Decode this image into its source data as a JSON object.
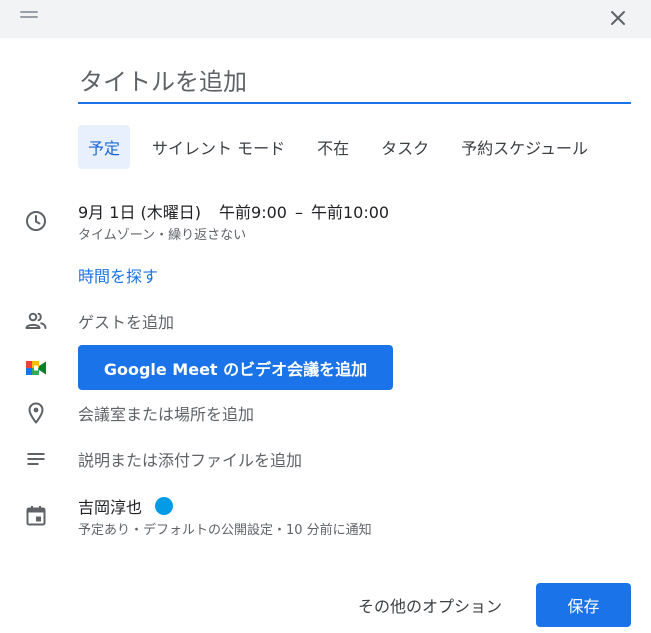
{
  "dialog": {
    "close_label": "×"
  },
  "title_field": {
    "placeholder": "タイトルを追加",
    "value": ""
  },
  "tabs": [
    {
      "label": "予定",
      "active": true
    },
    {
      "label": "サイレント モード",
      "active": false
    },
    {
      "label": "不在",
      "active": false
    },
    {
      "label": "タスク",
      "active": false
    },
    {
      "label": "予約スケジュール",
      "active": false
    }
  ],
  "datetime": {
    "date": "9月 1日 (木曜日)",
    "start": "午前9:00",
    "separator": "–",
    "end": "午前10:00",
    "timezone_repeat": "タイムゾーン・繰り返さない"
  },
  "find_time": "時間を探す",
  "guests": "ゲストを追加",
  "meet_button": "Google Meet のビデオ会議を追加",
  "location": "会議室または場所を追加",
  "description": "説明または添付ファイルを追加",
  "calendar": {
    "owner": "吉岡淳也",
    "status": "予定あり・デフォルトの公開設定・10 分前に通知",
    "color": "#039be5"
  },
  "footer": {
    "more_options": "その他のオプション",
    "save": "保存"
  },
  "colors": {
    "accent": "#1a73e8",
    "tab_active_bg": "#e8f0fe",
    "topbar": "#f1f3f4"
  },
  "icons": [
    "drag-handle-icon",
    "close-icon",
    "clock-icon",
    "people-icon",
    "google-meet-icon",
    "location-pin-icon",
    "notes-icon",
    "calendar-icon"
  ]
}
